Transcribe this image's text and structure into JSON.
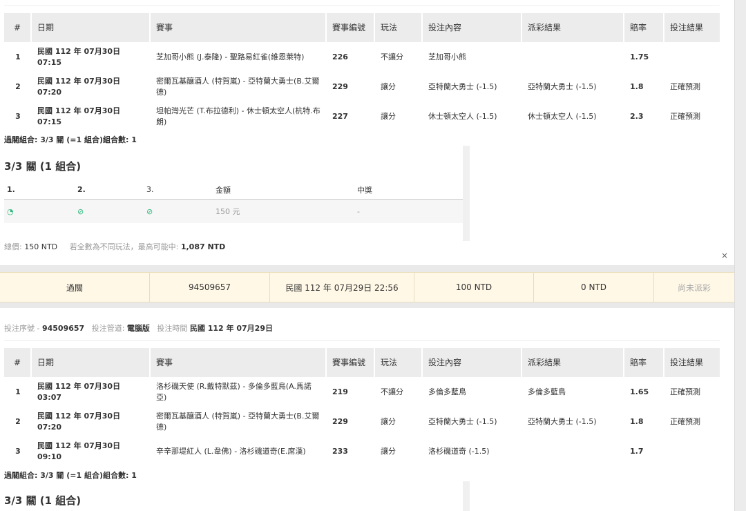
{
  "table_headers": [
    "#",
    "日期",
    "賽事",
    "賽事編號",
    "玩法",
    "投注內容",
    "派彩結果",
    "賠率",
    "投注結果"
  ],
  "panel1": {
    "rows": [
      {
        "no": "1",
        "date": "民國 112 年 07月30日",
        "time": "07:15",
        "match": "芝加哥小熊 (J.泰隆) - 聖路易紅雀(維恩萊特)",
        "match_id": "226",
        "play": "不讓分",
        "bet": "芝加哥小熊",
        "payout": "",
        "odds": "1.75",
        "result": ""
      },
      {
        "no": "2",
        "date": "民國 112 年 07月30日",
        "time": "07:20",
        "match": "密爾瓦基釀酒人 (特賀嵐) - 亞特蘭大勇士(B.艾爾德)",
        "match_id": "229",
        "play": "讓分",
        "bet": "亞特蘭大勇士 (-1.5)",
        "payout": "亞特蘭大勇士 (-1.5)",
        "odds": "1.8",
        "result": "正確預測"
      },
      {
        "no": "3",
        "date": "民國 112 年 07月30日",
        "time": "07:15",
        "match": "坦帕灣光芒 (T.布拉德利) - 休士頓太空人(杭特.布朗)",
        "match_id": "227",
        "play": "讓分",
        "bet": "休士頓太空人 (-1.5)",
        "payout": "休士頓太空人 (-1.5)",
        "odds": "2.3",
        "result": "正確預測"
      }
    ],
    "parlay_line": "過關組合: 3/3 關 (=1 組合)組合數: 1",
    "combo_title": "3/3 關 (1 組合)",
    "combo_headers": [
      "1.",
      "2.",
      "3.",
      "金額",
      "中獎"
    ],
    "combo_row": {
      "c1": "◔",
      "c2": "⊘",
      "c3": "⊘",
      "amount": "150 元",
      "win": "-"
    },
    "total_label": "總價:",
    "total_value": "150 NTD",
    "max_label": "若全數為不同玩法，最高可能中:",
    "max_value": "1,087 NTD"
  },
  "summary_bar": [
    "過關",
    "94509657",
    "民國 112 年 07月29日 22:56",
    "100 NTD",
    "0 NTD",
    "尚未派彩"
  ],
  "meta": {
    "serial_label": "投注序號 -",
    "serial": "94509657",
    "channel_label": "投注管道:",
    "channel": "電腦版",
    "time_label": "投注時間",
    "time": "民國 112 年 07月29日"
  },
  "panel2": {
    "rows": [
      {
        "no": "1",
        "date": "民國 112 年 07月30日",
        "time": "03:07",
        "match": "洛杉磯天使 (R.戴特默茲) - 多倫多藍鳥(A.馬諾亞)",
        "match_id": "219",
        "play": "不讓分",
        "bet": "多倫多藍鳥",
        "payout": "多倫多藍鳥",
        "odds": "1.65",
        "result": "正確預測"
      },
      {
        "no": "2",
        "date": "民國 112 年 07月30日",
        "time": "07:20",
        "match": "密爾瓦基釀酒人 (特賀嵐) - 亞特蘭大勇士(B.艾爾德)",
        "match_id": "229",
        "play": "讓分",
        "bet": "亞特蘭大勇士 (-1.5)",
        "payout": "亞特蘭大勇士 (-1.5)",
        "odds": "1.8",
        "result": "正確預測"
      },
      {
        "no": "3",
        "date": "民國 112 年 07月30日",
        "time": "09:10",
        "match": "辛辛那堤紅人 (L.韋佛) - 洛杉磯道奇(E.席漢)",
        "match_id": "233",
        "play": "讓分",
        "bet": "洛杉磯道奇 (-1.5)",
        "payout": "",
        "odds": "1.7",
        "result": ""
      }
    ],
    "parlay_line": "過關組合: 3/3 關 (=1 組合)組合數: 1",
    "combo_title": "3/3 關 (1 組合)"
  },
  "close_icon": "×"
}
